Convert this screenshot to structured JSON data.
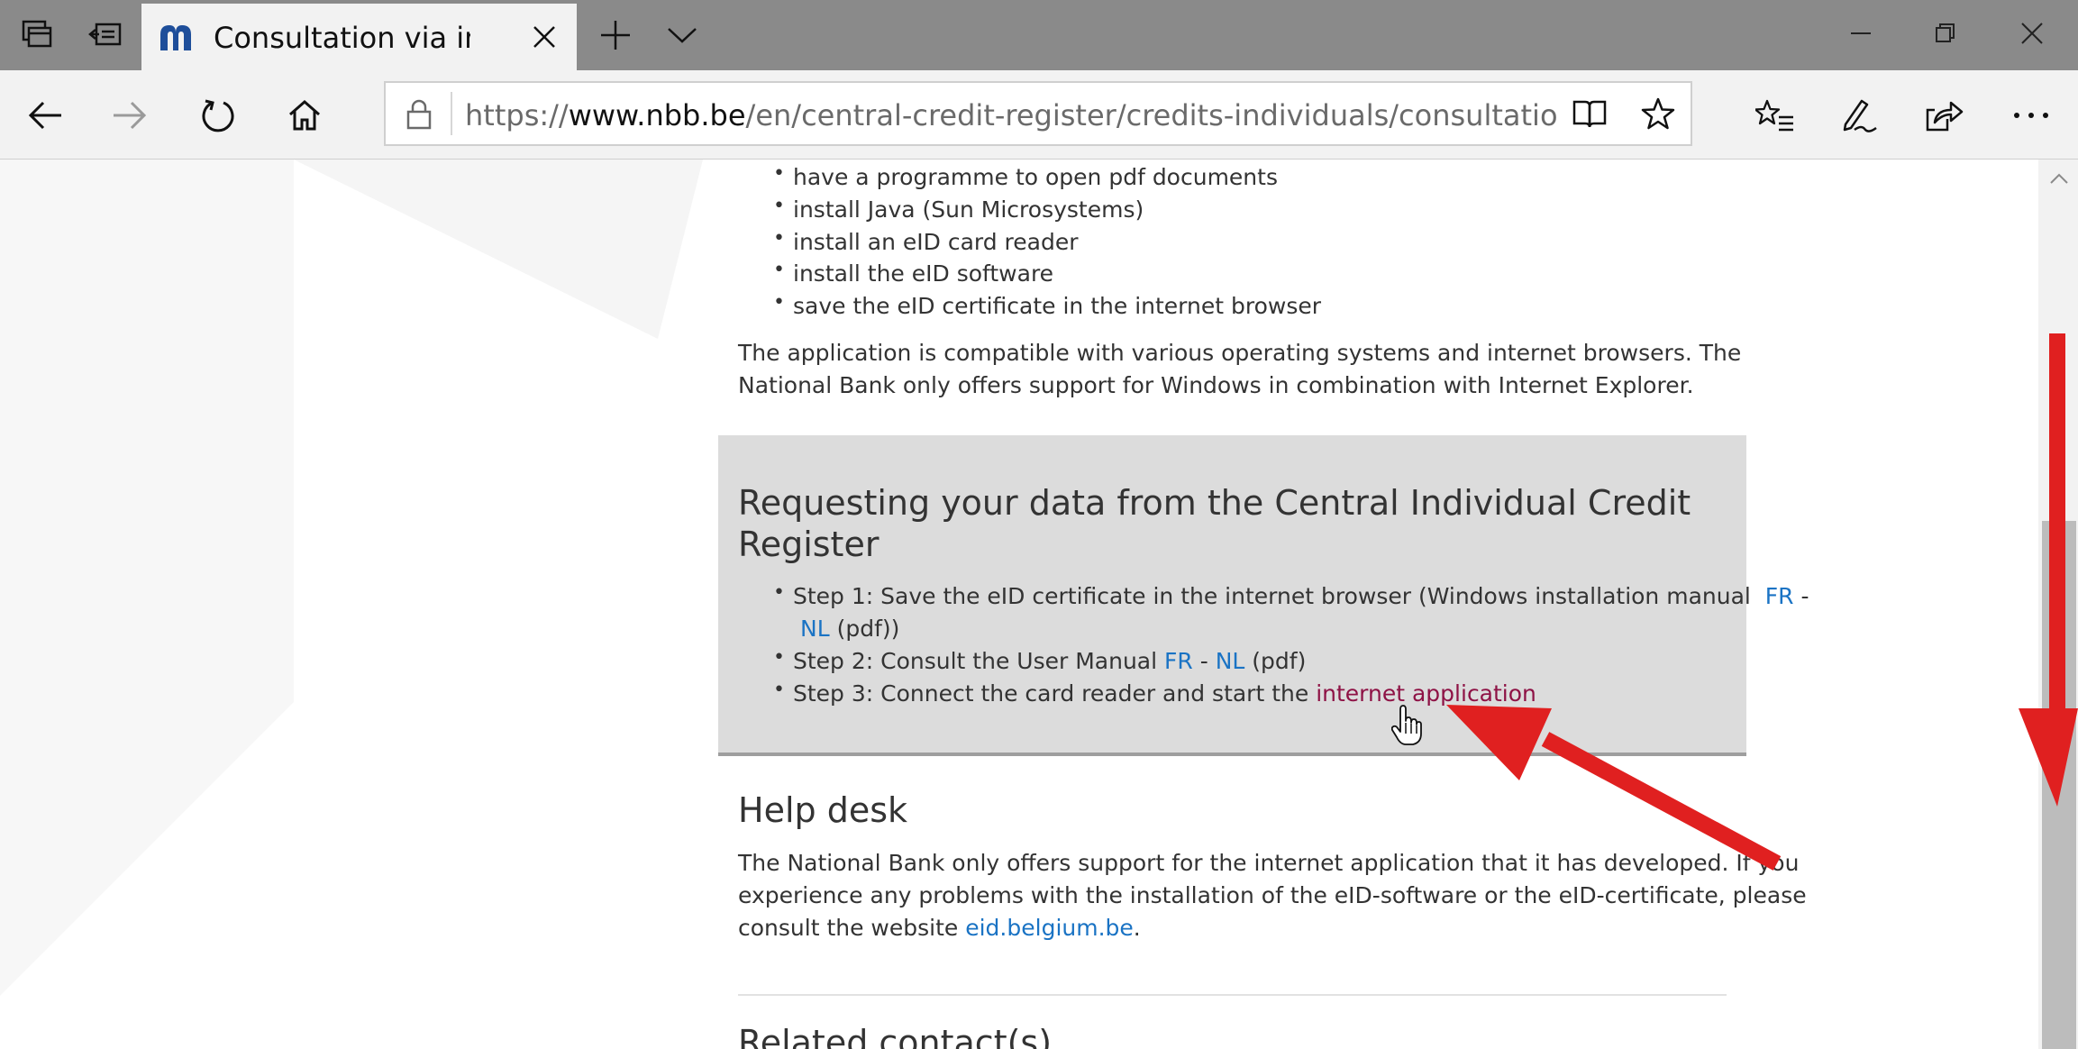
{
  "browser": {
    "tab_title": "Consultation via interne",
    "url_prefix": "https://",
    "url_domain": "www.nbb.be",
    "url_path": "/en/central-credit-register/credits-individuals/consultation/consulta",
    "icons": {
      "tab_actions": "tab-actions-icon",
      "set_aside": "set-aside-tabs-icon",
      "site_logo": "nbb-logo-icon",
      "close_tab": "close-icon",
      "new_tab": "plus-icon",
      "tab_list": "chevron-down-icon",
      "minimize": "minimize-icon",
      "restore": "restore-icon",
      "close_window": "close-icon",
      "back": "back-arrow-icon",
      "forward": "forward-arrow-icon",
      "refresh": "refresh-icon",
      "home": "home-icon",
      "lock": "lock-icon",
      "reading_view": "book-icon",
      "favorite": "star-icon",
      "favorites_hub": "favorites-list-icon",
      "notes": "pen-icon",
      "share": "share-icon",
      "more": "more-icon"
    }
  },
  "page": {
    "requirements": [
      "have a programme to open pdf documents",
      "install Java (Sun Microsystems)",
      "install an eID card reader",
      "install the eID software",
      "save the eID certificate in the internet browser"
    ],
    "compat_line1": "The application is compatible with various operating systems and internet browsers. The",
    "compat_line2": "National Bank only offers support for Windows in combination with Internet Explorer.",
    "request_heading_line1": "Requesting your data from the Central Individual Credit",
    "request_heading_line2": "Register",
    "step1_text": "Step 1: Save the eID certificate in the internet browser (Windows installation manual",
    "step1_fr": "FR",
    "step1_sep": " -",
    "step1_nl": "NL",
    "step1_tail": " (pdf))",
    "step2_text": "Step 2: Consult the User Manual ",
    "step2_fr": "FR",
    "step2_sep": " - ",
    "step2_nl": "NL",
    "step2_tail": " (pdf)",
    "step3_text": "Step 3: Connect the card reader and start the ",
    "step3_link": "internet application",
    "helpdesk_heading": "Help desk",
    "helpdesk_line1": "The National Bank only offers support for the internet application that it has developed. If you",
    "helpdesk_line2": "experience any problems with the installation of the eID-software or the eID-certificate, please",
    "helpdesk_line3_pre": "consult the website ",
    "helpdesk_link": "eid.belgium.be",
    "helpdesk_line3_post": ".",
    "related_heading": "Related contact(s)"
  },
  "colors": {
    "link": "#1a73c4",
    "visited_link": "#8e1245",
    "annotation": "#e02020",
    "gray_box": "#dcdcdc"
  }
}
